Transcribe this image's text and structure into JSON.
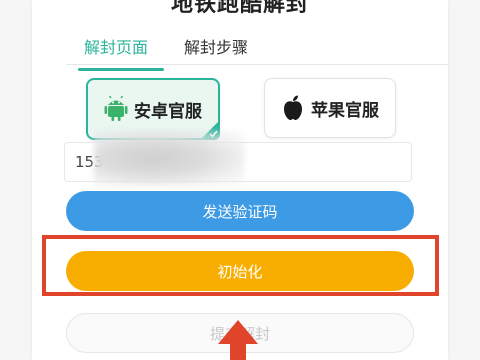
{
  "page": {
    "title_partial": "地铁跑酷解封"
  },
  "tabs": [
    {
      "label": "解封页面",
      "active": true
    },
    {
      "label": "解封步骤",
      "active": false
    }
  ],
  "platforms": [
    {
      "label": "安卓官服",
      "icon": "android-icon",
      "selected": true
    },
    {
      "label": "苹果官服",
      "icon": "apple-icon",
      "selected": false
    }
  ],
  "phone": {
    "value": "153"
  },
  "buttons": {
    "send_code": "发送验证码",
    "initialize": "初始化",
    "unseal": "提交解封"
  },
  "colors": {
    "accent": "#2bb49a",
    "send_code_bg": "#3d9be6",
    "initialize_bg": "#f8ae00",
    "highlight": "#e0452b"
  }
}
